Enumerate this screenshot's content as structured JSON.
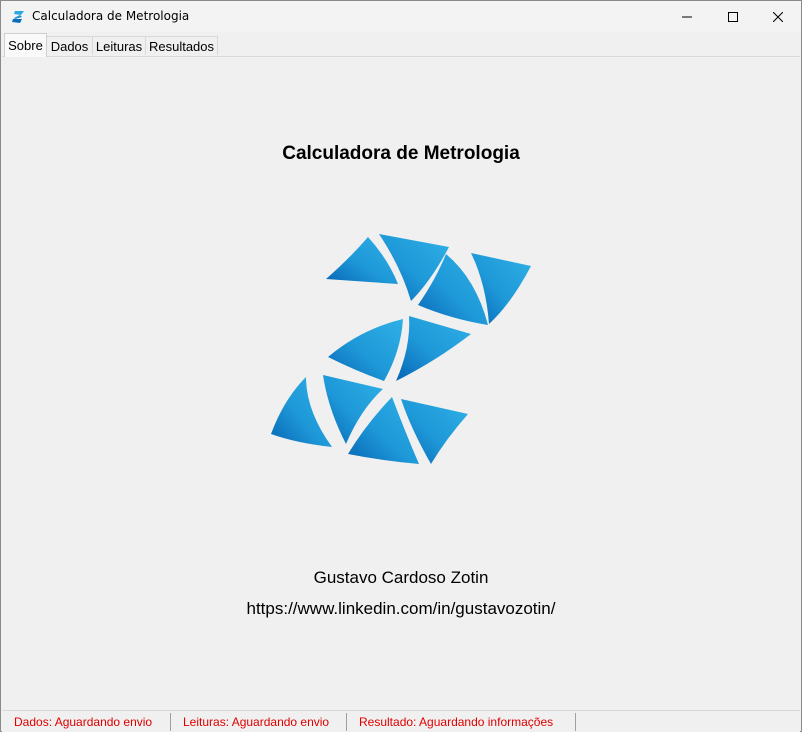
{
  "window": {
    "title": "Calculadora de Metrologia",
    "icon": "app-z-logo-icon",
    "controls": [
      "minimize-icon",
      "maximize-icon",
      "close-icon"
    ]
  },
  "tabs": [
    {
      "label": "Sobre",
      "active": true
    },
    {
      "label": "Dados",
      "active": false
    },
    {
      "label": "Leituras",
      "active": false
    },
    {
      "label": "Resultados",
      "active": false
    }
  ],
  "about": {
    "title": "Calculadora de Metrologia",
    "logo": "z-logo-image",
    "author": "Gustavo Cardoso Zotin",
    "link": "https://www.linkedin.com/in/gustavozotin/"
  },
  "status": [
    "Dados: Aguardando envio",
    "Leituras: Aguardando envio",
    "Resultado: Aguardando informações"
  ],
  "colors": {
    "status_text": "#e00000",
    "logo_light": "#29a8e0",
    "logo_dark": "#0a6fbb"
  }
}
